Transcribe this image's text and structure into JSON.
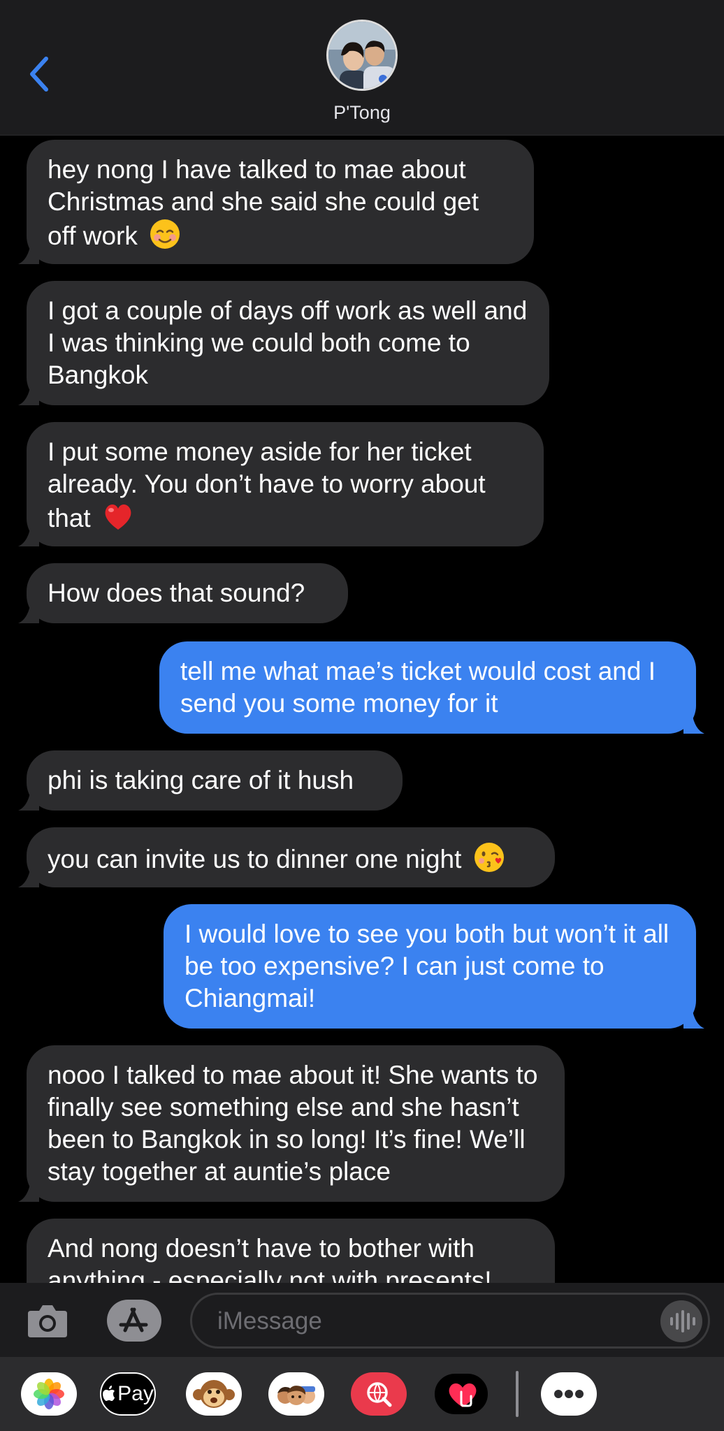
{
  "header": {
    "contact_name": "P'Tong",
    "back_icon": "chevron-left-icon",
    "accent_color": "#3b82f0"
  },
  "messages": [
    {
      "from": "contact",
      "text": "hey nong I have talked to mae about Christmas and she said she could get off work",
      "emoji": "smiling-face-icon"
    },
    {
      "from": "contact",
      "text": "I got a couple of days off work as well and I was thinking we could both come to Bangkok"
    },
    {
      "from": "contact",
      "text": "I put some money aside for her ticket already. You don’t have to worry about that",
      "emoji": "red-heart-icon"
    },
    {
      "from": "contact",
      "text": "How does that sound?"
    },
    {
      "from": "me",
      "text": "tell me what mae’s ticket would cost and I send you some money for it"
    },
    {
      "from": "contact",
      "text": "phi is taking care of it hush"
    },
    {
      "from": "contact",
      "text": "you can invite us to dinner one night",
      "emoji": "kissing-face-icon"
    },
    {
      "from": "me",
      "text": "I would love to see you both but won’t it all be too expensive? I can just come to Chiangmai!"
    },
    {
      "from": "contact",
      "text": "nooo I talked to mae about it! She wants to finally see something else and she hasn’t been to Bangkok in so long! It’s fine! We’ll stay together at auntie’s place"
    },
    {
      "from": "contact",
      "text": "And nong doesn’t have to bother with anything - especially not with presents!"
    }
  ],
  "input_bar": {
    "placeholder": "iMessage",
    "camera_icon": "camera-icon",
    "apps_icon": "app-store-icon",
    "audio_icon": "audio-waveform-icon"
  },
  "app_drawer": {
    "apps": [
      "Photos",
      "Apple Pay",
      "Animoji",
      "Memoji",
      "Image Search",
      "Digital Touch",
      "More"
    ],
    "pay_label": "Pay"
  }
}
